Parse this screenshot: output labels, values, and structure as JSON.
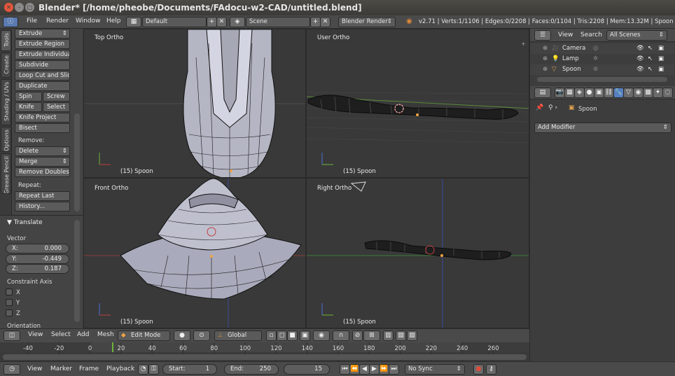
{
  "window": {
    "title": "Blender* [/home/pheobe/Documents/FAdocu-w2-CAD/untitled.blend]"
  },
  "info_header": {
    "menus": [
      "File",
      "Render",
      "Window",
      "Help"
    ],
    "screen_layout": "Default",
    "scene": "Scene",
    "render_engine": "Blender Render",
    "stats": "v2.71 | Verts:1/1106 | Edges:0/2208 | Faces:0/1104 | Tris:2208 | Mem:13.32M | Spoon"
  },
  "tool_tabs": [
    "Tools",
    "Create",
    "Shading / UVs",
    "Options",
    "Grease Pencil"
  ],
  "tools": {
    "extrude": "Extrude",
    "extrude_region": "Extrude Region",
    "extrude_individual": "Extrude Individual",
    "subdivide": "Subdivide",
    "loop_cut": "Loop Cut and Slide",
    "duplicate": "Duplicate",
    "spin": "Spin",
    "screw": "Screw",
    "knife": "Knife",
    "select": "Select",
    "knife_project": "Knife Project",
    "bisect": "Bisect",
    "remove_label": "Remove:",
    "delete": "Delete",
    "merge": "Merge",
    "remove_doubles": "Remove Doubles",
    "repeat_label": "Repeat:",
    "repeat_last": "Repeat Last",
    "history": "History..."
  },
  "operator_panel": {
    "title": "Translate",
    "vector_label": "Vector",
    "x_label": "X:",
    "x_value": "0.000",
    "y_label": "Y:",
    "y_value": "-0.449",
    "z_label": "Z:",
    "z_value": "0.187",
    "constraint_label": "Constraint Axis",
    "axis_x": "X",
    "axis_y": "Y",
    "axis_z": "Z",
    "orientation_label": "Orientation"
  },
  "viewports": {
    "top_left": {
      "label": "Top Ortho",
      "object": "(15) Spoon"
    },
    "top_right": {
      "label": "User Ortho",
      "object": "(15) Spoon"
    },
    "bottom_left": {
      "label": "Front Ortho",
      "object": "(15) Spoon"
    },
    "bottom_right": {
      "label": "Right Ortho",
      "object": "(15) Spoon"
    }
  },
  "view3d_header": {
    "menus": [
      "View",
      "Select",
      "Add",
      "Mesh"
    ],
    "mode": "Edit Mode",
    "orientation": "Global"
  },
  "timeline": {
    "ticks": [
      "-40",
      "-20",
      "0",
      "20",
      "40",
      "60",
      "80",
      "100",
      "120",
      "140",
      "160",
      "180",
      "200",
      "220",
      "240",
      "260"
    ],
    "current_frame": 15
  },
  "timeline_header": {
    "menus": [
      "View",
      "Marker",
      "Frame",
      "Playback"
    ],
    "start_label": "Start:",
    "start_value": "1",
    "end_label": "End:",
    "end_value": "250",
    "current": "15",
    "sync": "No Sync"
  },
  "outliner": {
    "view": "View",
    "search": "Search",
    "filter": "All Scenes",
    "items": [
      "Camera",
      "Lamp",
      "Spoon"
    ]
  },
  "properties": {
    "object_name": "Spoon",
    "add_modifier": "Add Modifier"
  },
  "colors": {
    "accent_blue": "#5680c2",
    "selection_orange": "#f1a342",
    "x_axis": "#c04040",
    "y_axis": "#6fb33a",
    "z_axis": "#4a6fd6"
  }
}
